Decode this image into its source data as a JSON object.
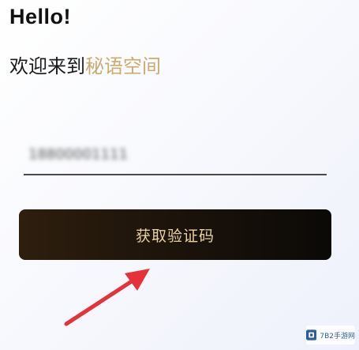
{
  "login": {
    "greeting": "Hello!",
    "welcome_prefix": "欢迎来到",
    "app_name": "秘语空间",
    "phone_value": "18800001111",
    "get_code_label": "获取验证码"
  },
  "watermark": {
    "text": "7B2手游网"
  },
  "colors": {
    "brand_gold": "#c9ac6e",
    "button_dark": "#1a120a",
    "button_text": "#e9d3a2",
    "arrow_red": "#e5323a"
  },
  "icons": {
    "annotation": "red-arrow-icon",
    "watermark_logo": "site-logo-icon"
  }
}
